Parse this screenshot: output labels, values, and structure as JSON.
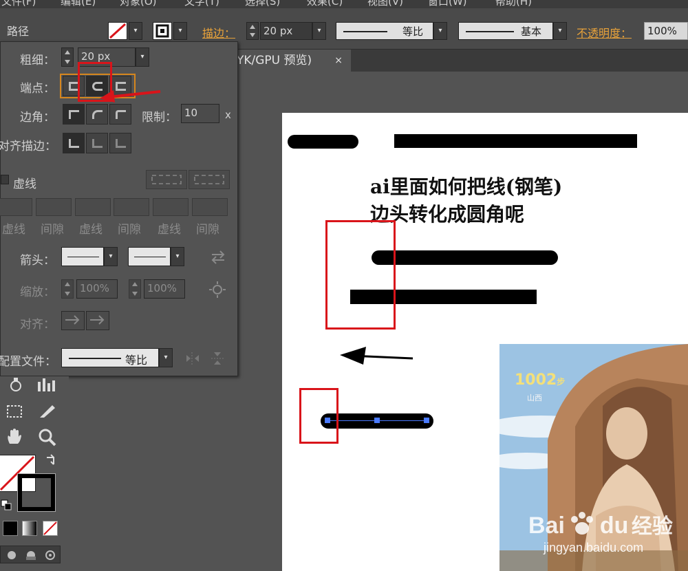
{
  "menubar": {
    "items": [
      "文件(F)",
      "编辑(E)",
      "对象(O)",
      "文字(T)",
      "选择(S)",
      "效果(C)",
      "视图(V)",
      "窗口(W)",
      "帮助(H)"
    ]
  },
  "control_bar": {
    "selection_label": "路径",
    "stroke_label": "描边：",
    "stroke_weight": "20 px",
    "profile": "等比",
    "brush": "基本",
    "opacity_label": "不透明度：",
    "opacity": "100%"
  },
  "document_tab": {
    "title": "YK/GPU 预览)",
    "close": "×"
  },
  "stroke_panel": {
    "weight_label": "粗细：",
    "weight": "20 px",
    "cap_label": "端点：",
    "corner_label": "边角：",
    "limit_label": "限制：",
    "limit": "10",
    "limit_unit": "x",
    "align_label": "对齐描边：",
    "dashed_label": "虚线",
    "dash_labels": [
      "虚线",
      "间隙",
      "虚线",
      "间隙",
      "虚线",
      "间隙"
    ],
    "arrow_label": "箭头：",
    "scale_label": "缩放：",
    "scale_start": "100%",
    "scale_end": "100%",
    "align_arrow_label": "对齐：",
    "profile_label": "配置文件：",
    "profile": "等比"
  },
  "artboard": {
    "title_line1": "ai里面如何把线(钢笔)",
    "title_line2": "边头转化成圆角呢"
  },
  "poster": {
    "steps": "1002",
    "steps_unit": "步",
    "location": "山西"
  },
  "watermark": {
    "brand_a": "Bai",
    "brand_b": "du",
    "brand_cn": "经验",
    "url": "jingyan.baidu.com"
  },
  "colors": {
    "accent": "#e8a23a",
    "highlight": "#d9141a",
    "panel": "#535353",
    "selection": "#4b7bff"
  }
}
